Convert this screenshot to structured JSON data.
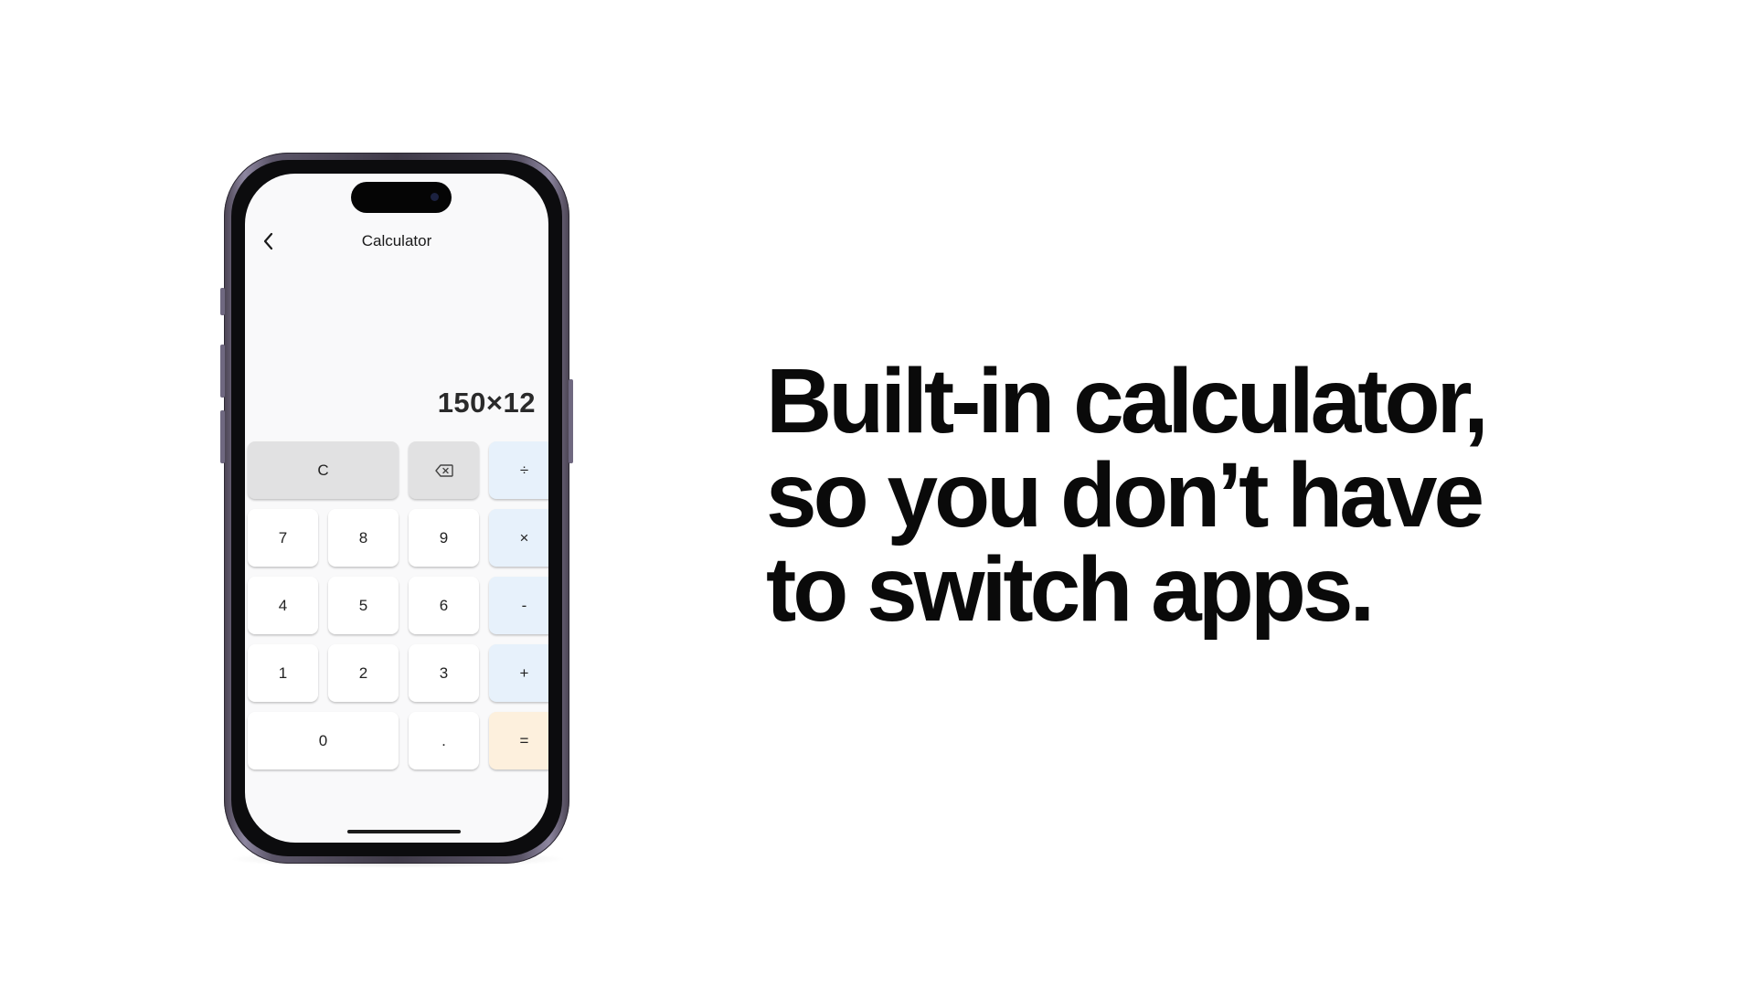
{
  "app": {
    "title": "Calculator"
  },
  "display": {
    "expression": "150×12"
  },
  "keypad": {
    "rows": [
      [
        {
          "label": "C",
          "style": "gray",
          "wide": true
        },
        {
          "label": "⌫",
          "style": "gray",
          "icon": "backspace-icon"
        },
        {
          "label": "÷",
          "style": "op"
        }
      ],
      [
        {
          "label": "7"
        },
        {
          "label": "8"
        },
        {
          "label": "9"
        },
        {
          "label": "×",
          "style": "op"
        }
      ],
      [
        {
          "label": "4"
        },
        {
          "label": "5"
        },
        {
          "label": "6"
        },
        {
          "label": "-",
          "style": "op"
        }
      ],
      [
        {
          "label": "1"
        },
        {
          "label": "2"
        },
        {
          "label": "3"
        },
        {
          "label": "+",
          "style": "op"
        }
      ],
      [
        {
          "label": "0",
          "wide": true
        },
        {
          "label": "."
        },
        {
          "label": "=",
          "style": "eq"
        }
      ]
    ]
  },
  "headline": {
    "lines": [
      "Built-in calculator,",
      "so you don’t have",
      "to switch apps."
    ]
  },
  "colors": {
    "operator_key": "#e7f1fb",
    "clear_key": "#e1e1e2",
    "equals_key": "#fdf0dd",
    "headline_text": "#0a0a0a"
  },
  "icons": {
    "back": "chevron-left-icon",
    "backspace": "backspace-icon"
  }
}
